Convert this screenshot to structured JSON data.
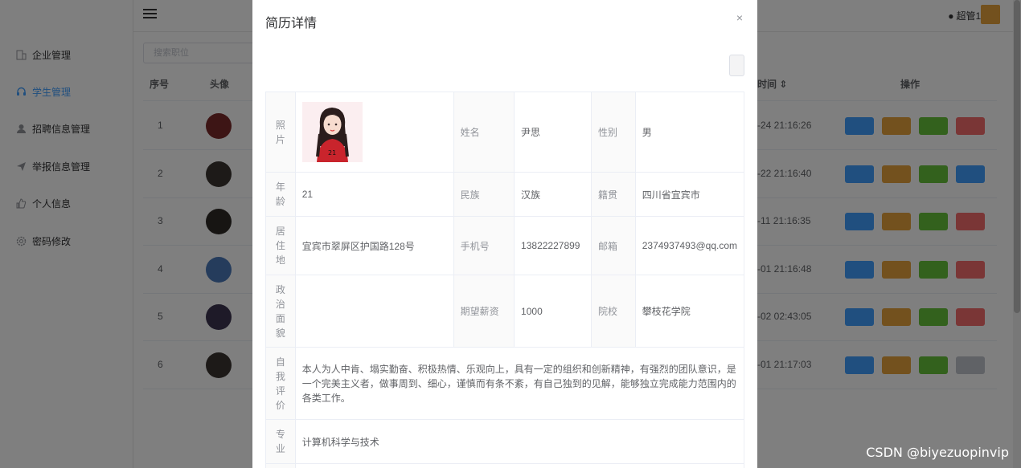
{
  "sidebar": {
    "items": [
      {
        "label": "企业管理",
        "icon": "building-icon"
      },
      {
        "label": "学生管理",
        "icon": "headset-icon",
        "active": true
      },
      {
        "label": "招聘信息管理",
        "icon": "user-icon"
      },
      {
        "label": "举报信息管理",
        "icon": "send-icon"
      },
      {
        "label": "个人信息",
        "icon": "thumb-icon"
      },
      {
        "label": "密码修改",
        "icon": "gear-icon"
      }
    ]
  },
  "topbar": {
    "user": "超管1"
  },
  "search": {
    "placeholder": "搜索职位"
  },
  "table": {
    "headers": [
      "序号",
      "头像",
      "时间",
      "操作"
    ],
    "rows": [
      {
        "index": "1",
        "time": "-24 21:16:26"
      },
      {
        "index": "2",
        "time": "-22 21:16:40"
      },
      {
        "index": "3",
        "time": "-11 21:16:35"
      },
      {
        "index": "4",
        "time": "-01 21:16:48"
      },
      {
        "index": "5",
        "time": "-02 02:43:05"
      },
      {
        "index": "6",
        "time": "-01 21:17:03"
      }
    ]
  },
  "dialog": {
    "title": "简历详情",
    "close": "×",
    "labels": {
      "photo": "照片",
      "name": "姓名",
      "gender": "性别",
      "age": "年龄",
      "ethnicity": "民族",
      "native": "籍贯",
      "address": "居住地",
      "phone": "手机号",
      "email": "邮箱",
      "politics": "政治面貌",
      "salary": "期望薪资",
      "school": "院校",
      "self_eval": "自我评价",
      "major": "专业"
    },
    "values": {
      "name": "尹思",
      "gender": "男",
      "age": "21",
      "ethnicity": "汉族",
      "native": "四川省宜宾市",
      "address": "宜宾市翠屏区护国路128号",
      "phone": "13822227899",
      "email": "2374937493@qq.com",
      "politics": "",
      "salary": "1000",
      "school": "攀枝花学院",
      "self_eval": "本人为人中肯、塌实勤奋、积极热情、乐观向上，具有一定的组织和创新精神，有强烈的团队意识，是一个完美主义者，做事周到、细心，谨慎而有条不紊，有自己独到的见解，能够独立完成能力范围内的各类工作。",
      "major": "计算机科学与技术"
    }
  },
  "watermark": "CSDN @biyezuopinvip"
}
